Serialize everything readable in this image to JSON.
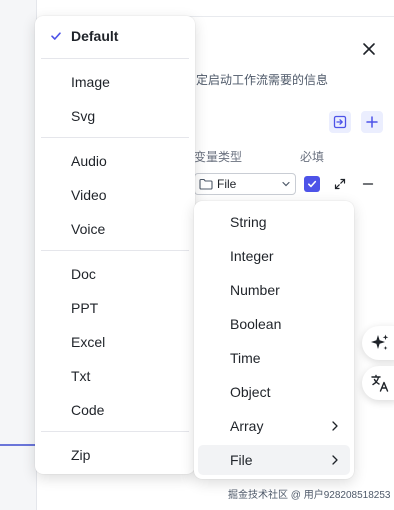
{
  "panel": {
    "subtitle": "定启动工作流需要的信息",
    "columns": {
      "type": "变量类型",
      "required": "必填"
    },
    "type_select_value": "File",
    "required_checked": true
  },
  "format_menu": {
    "items": [
      {
        "label": "Default",
        "selected": true
      },
      {
        "label": "Image"
      },
      {
        "label": "Svg"
      },
      {
        "label": "Audio"
      },
      {
        "label": "Video"
      },
      {
        "label": "Voice"
      },
      {
        "label": "Doc"
      },
      {
        "label": "PPT"
      },
      {
        "label": "Excel"
      },
      {
        "label": "Txt"
      },
      {
        "label": "Code"
      },
      {
        "label": "Zip"
      }
    ]
  },
  "type_menu": {
    "items": [
      {
        "label": "String"
      },
      {
        "label": "Integer"
      },
      {
        "label": "Number"
      },
      {
        "label": "Boolean"
      },
      {
        "label": "Time"
      },
      {
        "label": "Object"
      },
      {
        "label": "Array",
        "submenu": true
      },
      {
        "label": "File",
        "submenu": true,
        "active": true
      }
    ]
  },
  "icons": {
    "close": "close-icon",
    "import": "import-icon",
    "add": "plus-icon",
    "expand": "expand-icon",
    "remove": "minus-icon",
    "ai": "sparkle-icon",
    "translate": "translate-icon"
  },
  "colors": {
    "accent": "#4d53e8",
    "accent_light": "#ebeefe"
  },
  "watermark": "掘金技术社区 @ 用户928208518253"
}
